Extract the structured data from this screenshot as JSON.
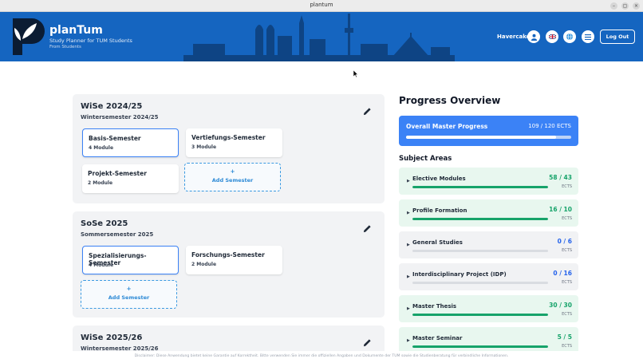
{
  "window": {
    "title": "plantum"
  },
  "header": {
    "brand": "planTum",
    "subtitle": "Study Planner for TUM Students",
    "from": "From Students",
    "user": "Havercake",
    "logout": "Log Out",
    "icons": [
      "user-icon",
      "uk-flag-icon",
      "globe-icon",
      "menu-icon"
    ],
    "accent": "#1565c0"
  },
  "semesters": [
    {
      "title": "WiSe 2024/25",
      "subtitle": "Wintersemester 2024/25",
      "modules": [
        {
          "name": "Basis-Semester",
          "count": "4 Module",
          "selected": true
        },
        {
          "name": "Vertiefungs-Semester",
          "count": "3 Module",
          "selected": false
        },
        {
          "name": "Projekt-Semester",
          "count": "2 Module",
          "selected": false
        }
      ],
      "add_plus": "+",
      "add_label": "Add Semester"
    },
    {
      "title": "SoSe 2025",
      "subtitle": "Sommersemester 2025",
      "modules": [
        {
          "name": "Spezialisierungs-Semester",
          "count": "4 Module",
          "selected": true
        },
        {
          "name": "Forschungs-Semester",
          "count": "2 Module",
          "selected": false
        }
      ],
      "add_plus": "+",
      "add_label": "Add Semester"
    },
    {
      "title": "WiSe 2025/26",
      "subtitle": "Wintersemester 2025/26"
    }
  ],
  "progress": {
    "title": "Progress Overview",
    "overall_label": "Overall Master Progress",
    "overall_value": "109 / 120 ECTS",
    "overall_fraction": 0.908,
    "areas_title": "Subject Areas",
    "areas": [
      {
        "name": "Elective Modules",
        "value": "58 / 43",
        "unit": "ECTS",
        "fraction": 1.0,
        "status": "green"
      },
      {
        "name": "Profile Formation",
        "value": "16 / 10",
        "unit": "ECTS",
        "fraction": 1.0,
        "status": "green"
      },
      {
        "name": "General Studies",
        "value": "0 / 6",
        "unit": "ECTS",
        "fraction": 0.0,
        "status": "grey"
      },
      {
        "name": "Interdisciplinary Project (IDP)",
        "value": "0 / 16",
        "unit": "ECTS",
        "fraction": 0.0,
        "status": "grey"
      },
      {
        "name": "Master Thesis",
        "value": "30 / 30",
        "unit": "ECTS",
        "fraction": 1.0,
        "status": "green"
      },
      {
        "name": "Master Seminar",
        "value": "5 / 5",
        "unit": "ECTS",
        "fraction": 1.0,
        "status": "green"
      }
    ]
  },
  "footer": {
    "disclaimer": "Disclaimer: Diese Anwendung bietet keine Garantie auf Korrektheit. Bitte verwenden Sie immer die offiziellen Angaben und Dokumente der TUM sowie die Studienberatung für verbindliche Informationen."
  }
}
